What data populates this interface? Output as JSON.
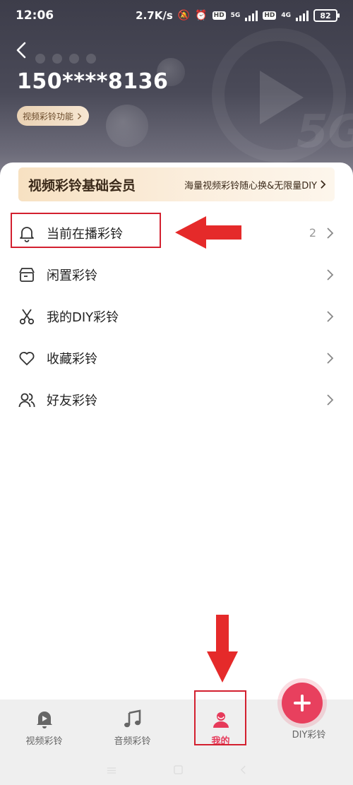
{
  "status_bar": {
    "time": "12:06",
    "net_speed": "2.7K/s",
    "hd1": "HD",
    "net1": "5G",
    "hd2": "HD",
    "net2": "4G",
    "battery": "82"
  },
  "header": {
    "phone": "150****8136",
    "feature_pill": "视频彩铃功能"
  },
  "vip": {
    "title": "视频彩铃基础会员",
    "desc": "海量视频彩铃随心换&无限量DIY"
  },
  "menu": [
    {
      "label": "当前在播彩铃",
      "count": "2",
      "icon": "bell-icon"
    },
    {
      "label": "闲置彩铃",
      "icon": "box-icon"
    },
    {
      "label": "我的DIY彩铃",
      "icon": "scissors-icon"
    },
    {
      "label": "收藏彩铃",
      "icon": "heart-icon"
    },
    {
      "label": "好友彩铃",
      "icon": "friends-icon"
    }
  ],
  "tabs": [
    {
      "label": "视频彩铃",
      "icon": "video-bell-icon"
    },
    {
      "label": "音频彩铃",
      "icon": "music-note-icon"
    },
    {
      "label": "我的",
      "icon": "user-icon"
    },
    {
      "label": "DIY彩铃",
      "icon": "plus-icon"
    }
  ],
  "colors": {
    "accent": "#e63a5a",
    "annotation_red": "#d3202f",
    "vip_gold": "#f7e1c2"
  }
}
